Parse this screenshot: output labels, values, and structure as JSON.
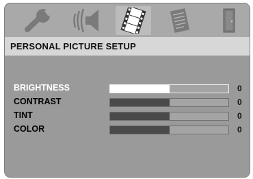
{
  "menu": {
    "icons": [
      {
        "name": "wrench-icon",
        "active": false
      },
      {
        "name": "speaker-icon",
        "active": false
      },
      {
        "name": "film-icon",
        "active": true
      },
      {
        "name": "document-icon",
        "active": false
      },
      {
        "name": "door-exit-icon",
        "active": false
      }
    ]
  },
  "header": {
    "title": "PERSONAL PICTURE SETUP"
  },
  "settings": [
    {
      "label": "BRIGHTNESS",
      "value": "0",
      "level": 0.5,
      "selected": true
    },
    {
      "label": "CONTRAST",
      "value": "0",
      "level": 0.5,
      "selected": false
    },
    {
      "label": "TINT",
      "value": "0",
      "level": 0.5,
      "selected": false
    },
    {
      "label": "COLOR",
      "value": "0",
      "level": 0.5,
      "selected": false
    }
  ],
  "colors": {
    "panel": "#9a9a9a",
    "icon_bar": "#a9a9a9",
    "header_bar": "#d7d7d7",
    "selected_text": "#ffffff",
    "slider_fill": "#4a4a4a"
  }
}
